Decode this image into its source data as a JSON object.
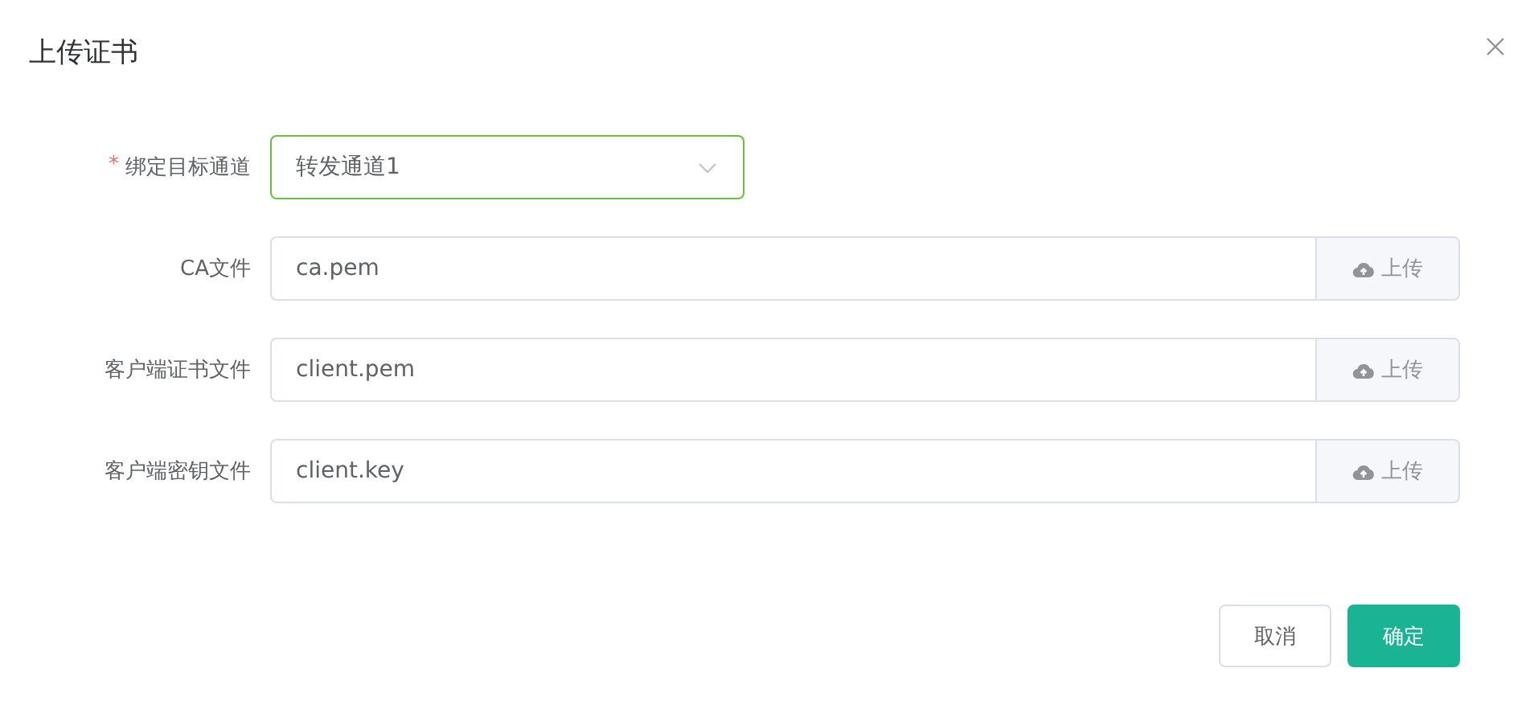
{
  "dialog": {
    "title": "上传证书"
  },
  "fields": [
    {
      "kind": "select",
      "label": "绑定目标通道",
      "required_mark": "*",
      "focused": true,
      "value": "转发通道1"
    },
    {
      "kind": "upload",
      "label": "CA文件",
      "focused": false,
      "value": "ca.pem",
      "button": "上传"
    },
    {
      "kind": "upload",
      "label": "客户端证书文件",
      "focused": false,
      "value": "client.pem",
      "button": "上传"
    },
    {
      "kind": "upload",
      "label": "客户端密钥文件",
      "focused": false,
      "value": "client.key",
      "button": "上传"
    }
  ],
  "buttons": [
    {
      "label": "取消",
      "kind": "default"
    },
    {
      "label": "确定",
      "kind": "primary"
    }
  ]
}
